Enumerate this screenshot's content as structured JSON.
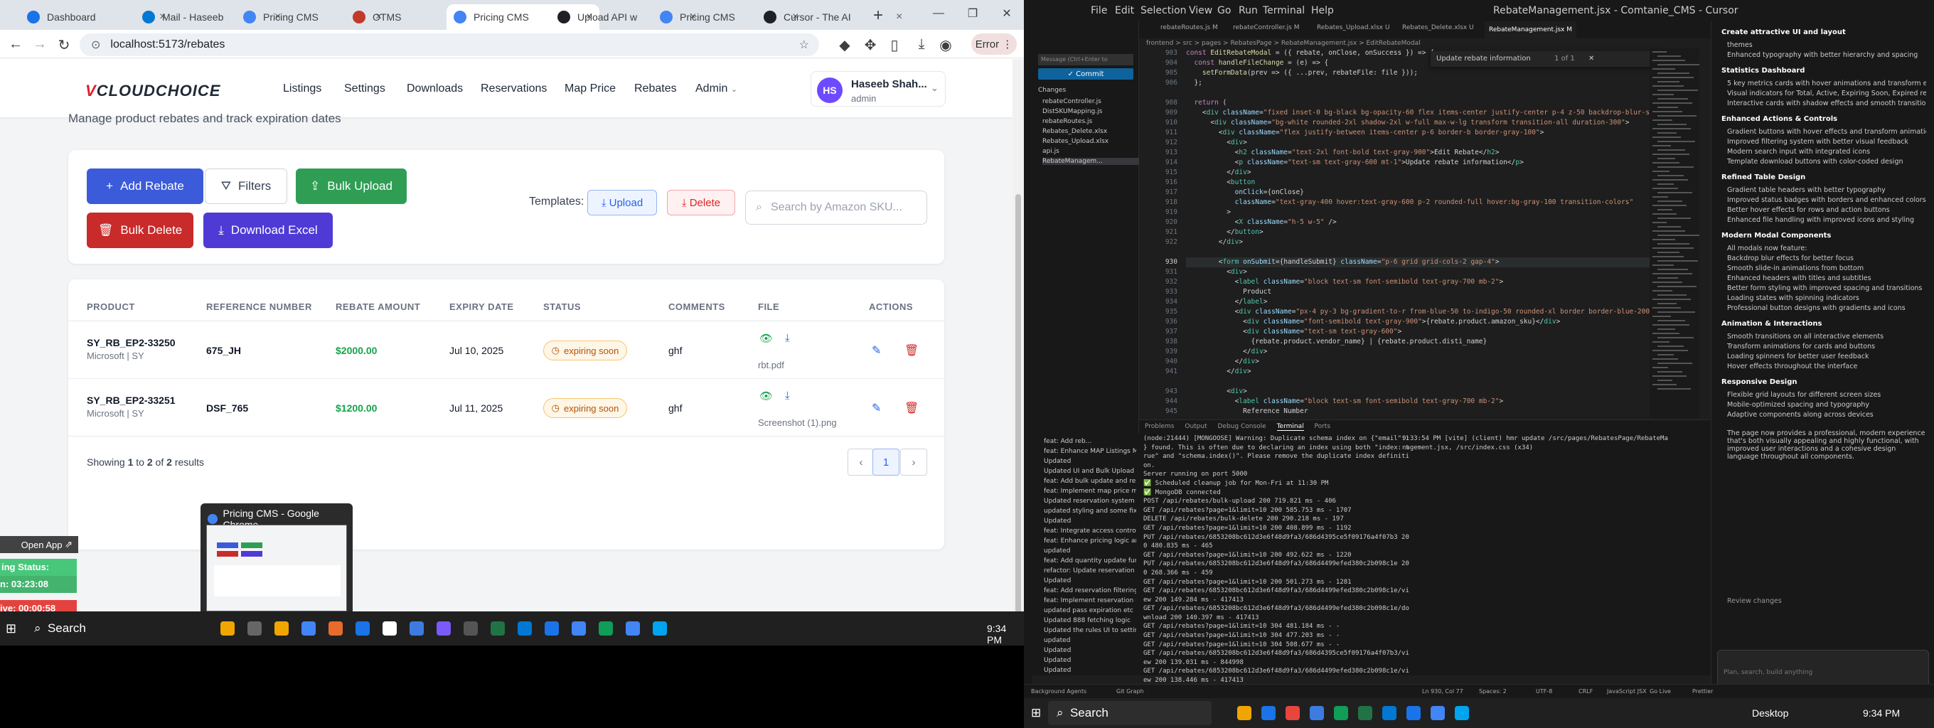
{
  "chrome": {
    "tabs": [
      {
        "title": "Dashboard",
        "color": "#1a73e8"
      },
      {
        "title": "Mail - Haseeb",
        "color": "#0078d4"
      },
      {
        "title": "Pricing CMS",
        "color": "#4285f4"
      },
      {
        "title": "OTMS",
        "color": "#c0392b"
      },
      {
        "title": "Pricing CMS",
        "color": "#4285f4"
      },
      {
        "title": "Upload API w",
        "color": "#202124"
      },
      {
        "title": "Pricing CMS",
        "color": "#4285f4"
      },
      {
        "title": "Cursor - The AI",
        "color": "#202124"
      }
    ],
    "url": "localhost:5173/rebates",
    "error_label": "Error"
  },
  "app": {
    "logo_prefix": "V",
    "logo_text": "CLOUDCHOICE",
    "nav": [
      "Listings",
      "Settings",
      "Downloads",
      "Reservations",
      "Map Price",
      "Rebates",
      "Admin"
    ],
    "user": {
      "initials": "HS",
      "name": "Haseeb Shah...",
      "role": "admin"
    },
    "subtitle": "Manage product rebates and track expiration dates",
    "buttons": {
      "add": "Add Rebate",
      "filters": "Filters",
      "bulk_upload": "Bulk Upload",
      "bulk_delete": "Bulk Delete",
      "download": "Download Excel",
      "templates": "Templates:",
      "upload": "Upload",
      "delete": "Delete"
    },
    "search_placeholder": "Search by Amazon SKU...",
    "columns": [
      "PRODUCT",
      "REFERENCE NUMBER",
      "REBATE AMOUNT",
      "EXPIRY DATE",
      "STATUS",
      "COMMENTS",
      "FILE",
      "ACTIONS"
    ],
    "rows": [
      {
        "sku": "SY_RB_EP2-33250",
        "vendor": "Microsoft | SY",
        "ref": "675_JH",
        "amount": "$2000.00",
        "expiry": "Jul 10, 2025",
        "status": "expiring soon",
        "comment": "ghf",
        "file": "rbt.pdf"
      },
      {
        "sku": "SY_RB_EP2-33251",
        "vendor": "Microsoft | SY",
        "ref": "DSF_765",
        "amount": "$1200.00",
        "expiry": "Jul 11, 2025",
        "status": "expiring soon",
        "comment": "ghf",
        "file": "Screenshot (1).png"
      }
    ],
    "pagination": {
      "showing_prefix": "Showing",
      "from": "1",
      "to_word": "to",
      "to": "2",
      "of_word": "of",
      "total": "2",
      "results": "results",
      "page": "1"
    }
  },
  "overlays": {
    "open_app": "Open App",
    "sync": "ing Status: Active",
    "timer": "n: 03:23:08",
    "live": "ive: 00:00:58",
    "thumb_title": "Pricing CMS - Google Chrome"
  },
  "taskbar": {
    "search": "Search",
    "time": "9:34 PM",
    "desktop": "Desktop"
  },
  "cursor": {
    "menu": [
      "File",
      "Edit",
      "Selection",
      "View",
      "Go",
      "Run",
      "Terminal",
      "Help"
    ],
    "title": "RebateManagement.jsx - Comtanie_CMS - Cursor",
    "tabs": [
      "rebateRoutes.js M",
      "rebateController.js M",
      "Rebates_Upload.xlsx U",
      "Rebates_Delete.xlsx U",
      "RebateManagement.jsx M"
    ],
    "breadcrumb": "frontend > src > pages > RebatesPage > RebateManagement.jsx > EditRebateModal",
    "find": "Update rebate information",
    "find_count": "1 of 1",
    "commit": "Commit",
    "message_placeholder": "Message (Ctrl+Enter to commit...)",
    "changes_label": "Changes",
    "changes": [
      "rebateController.js",
      "DistSKUMapping.js",
      "rebateRoutes.js",
      "Rebates_Delete.xlsx",
      "Rebates_Upload.xlsx",
      "api.js",
      "RebateManagem..."
    ],
    "chat_sections": [
      {
        "h": "Create attractive UI and layout",
        "items": [
          "themes",
          "Enhanced typography with better hierarchy and spacing"
        ]
      },
      {
        "h": "Statistics Dashboard",
        "items": [
          "5 key metrics cards with hover animations and transform effects",
          "Visual indicators for Total, Active, Expiring Soon, Expired rebates, and Total Value",
          "Interactive cards with shadow effects and smooth transitions"
        ]
      },
      {
        "h": "Enhanced Actions & Controls",
        "items": [
          "Gradient buttons with hover effects and transform animations",
          "Improved filtering system with better visual feedback",
          "Modern search input with integrated icons",
          "Template download buttons with color-coded design"
        ]
      },
      {
        "h": "Refined Table Design",
        "items": [
          "Gradient table headers with better typography",
          "Improved status badges with borders and enhanced colors",
          "Better hover effects for rows and action buttons",
          "Enhanced file handling with improved icons and styling"
        ]
      },
      {
        "h": "Modern Modal Components",
        "items": [
          "All modals now feature:",
          "Backdrop blur effects for better focus",
          "Smooth slide-in animations from bottom",
          "Enhanced headers with titles and subtitles",
          "Better form styling with improved spacing and transitions",
          "Loading states with spinning indicators",
          "Professional button designs with gradients and icons"
        ]
      },
      {
        "h": "Animation & Interactions",
        "items": [
          "Smooth transitions on all interactive elements",
          "Transform animations for cards and buttons",
          "Loading spinners for better user feedback",
          "Hover effects throughout the interface"
        ]
      },
      {
        "h": "Responsive Design",
        "items": [
          "Flexible grid layouts for different screen sizes",
          "Mobile-optimized spacing and typography",
          "Adaptive components along across devices"
        ]
      }
    ],
    "chat_summary": "The page now provides a professional, modern experience that's both visually appealing and highly functional, with improved user interactions and a cohesive design language throughout all components.",
    "review": "Review changes",
    "chat_placeholder": "Plan, search, build anything",
    "panel_tabs": [
      "Problems",
      "Output",
      "Debug Console",
      "Terminal",
      "Ports"
    ],
    "terminal": [
      "(node:21444) [MONGOOSE] Warning: Duplicate schema index on {\"email\":1",
      "} found. This is often due to declaring an index using both \"index: t",
      "rue\" and \"schema.index()\". Please remove the duplicate index definiti",
      "on.",
      "Server running on port 5000",
      "✅ Scheduled cleanup job for Mon-Fri at 11:30 PM",
      "✅ MongoDB connected",
      "POST /api/rebates/bulk-upload 200 719.821 ms - 406",
      "GET /api/rebates?page=1&limit=10 200 585.753 ms - 1707",
      "DELETE /api/rebates/bulk-delete 200 290.218 ms - 197",
      "GET /api/rebates?page=1&limit=10 200 408.899 ms - 1192",
      "PUT /api/rebates/6853208bc612d3e6f48d9fa3/686d4395ce5f09176a4f07b3 20",
      "0 480.835 ms - 465",
      "GET /api/rebates?page=1&limit=10 200 492.622 ms - 1220",
      "PUT /api/rebates/6853208bc612d3e6f48d9fa3/686d4499efed380c2b098c1e 20",
      "0 268.366 ms - 459",
      "GET /api/rebates?page=1&limit=10 200 501.273 ms - 1281",
      "GET /api/rebates/6853208bc612d3e6f48d9fa3/686d4499efed380c2b098c1e/vi",
      "ew 200 149.284 ms - 417413",
      "GET /api/rebates/6853208bc612d3e6f48d9fa3/686d4499efed380c2b098c1e/do",
      "wnload 200 140.397 ms - 417413",
      "GET /api/rebates?page=1&limit=10 304 481.184 ms - -",
      "GET /api/rebates?page=1&limit=10 304 477.203 ms - -",
      "GET /api/rebates?page=1&limit=10 304 508.677 ms - -",
      "GET /api/rebates/6853208bc612d3e6f48d9fa3/686d4395ce5f09176a4f07b3/vi",
      "ew 200 139.031 ms - 844998",
      "GET /api/rebates/6853208bc612d3e6f48d9fa3/686d4499efed380c2b098c1e/vi",
      "ew 200 138.446 ms - 417413"
    ],
    "terminal2": [
      "9:33:54 PM [vite] (client) hmr update /src/pages/RebatesPage/RebateMa",
      "nagement.jsx, /src/index.css (x34)"
    ],
    "git_log": [
      "feat: Add reb...",
      "feat: Enhance MAP Listings Man...",
      "Updated",
      "Updated UI and Bulk Upload an...",
      "feat: Add bulk update and remo...",
      "feat: Implement map price man...",
      "Updated reservation system Ho...",
      "updated styling and some fixes...",
      "Updated",
      "feat: Integrate access control an...",
      "feat: Enhance pricing logic and ...",
      "updated",
      "feat: Add quantity update functi...",
      "refactor: Update reservation rou...",
      "Updated",
      "feat: Add reservation filtering an...",
      "feat: Implement reservation ma...",
      "updated pass expiration etc",
      "Updated 888 fetching logic",
      "Updated the rules UI to settings...",
      "updated",
      "Updated",
      "Updated",
      "Updated"
    ],
    "status_items": [
      "Background Agents",
      "Git Graph",
      "Ln 930, Col 77",
      "Spaces: 2",
      "UTF-8",
      "CRLF",
      "JavaScript JSX",
      "Go Live",
      "Prettier"
    ]
  }
}
